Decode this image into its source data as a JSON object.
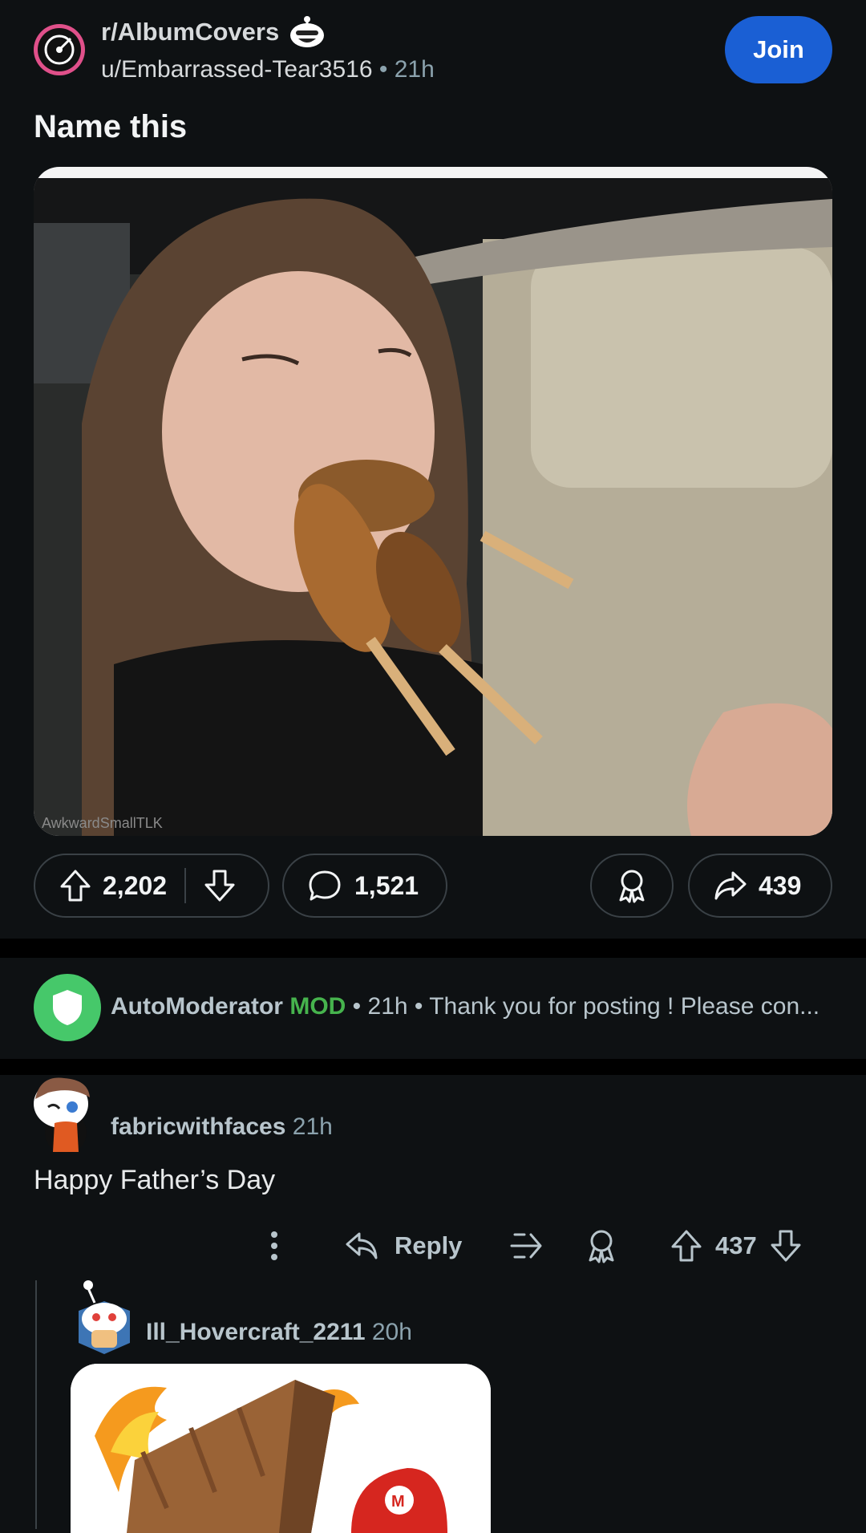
{
  "post": {
    "subreddit": "r/AlbumCovers",
    "author": "u/Embarrassed-Tear3516",
    "age": "21h",
    "join_label": "Join",
    "title": "Name this",
    "image_watermark": "AwkwardSmallTLK",
    "upvotes": "2,202",
    "comments": "1,521",
    "shares": "439"
  },
  "automod": {
    "name": "AutoModerator",
    "badge": "MOD",
    "meta": "• 21h • Thank you for posting ! Please con..."
  },
  "comment": {
    "author": "fabricwithfaces",
    "age": "21h",
    "body": "Happy Father’s Day",
    "reply_label": "Reply",
    "score": "437"
  },
  "reply": {
    "author": "Ill_Hovercraft_2211",
    "age": "20h"
  },
  "colors": {
    "background": "#0e1113",
    "join": "#1a5fd4",
    "mod_green": "#46b34d",
    "automod_avatar": "#46c86a",
    "subreddit_ring": "#e0508a"
  }
}
